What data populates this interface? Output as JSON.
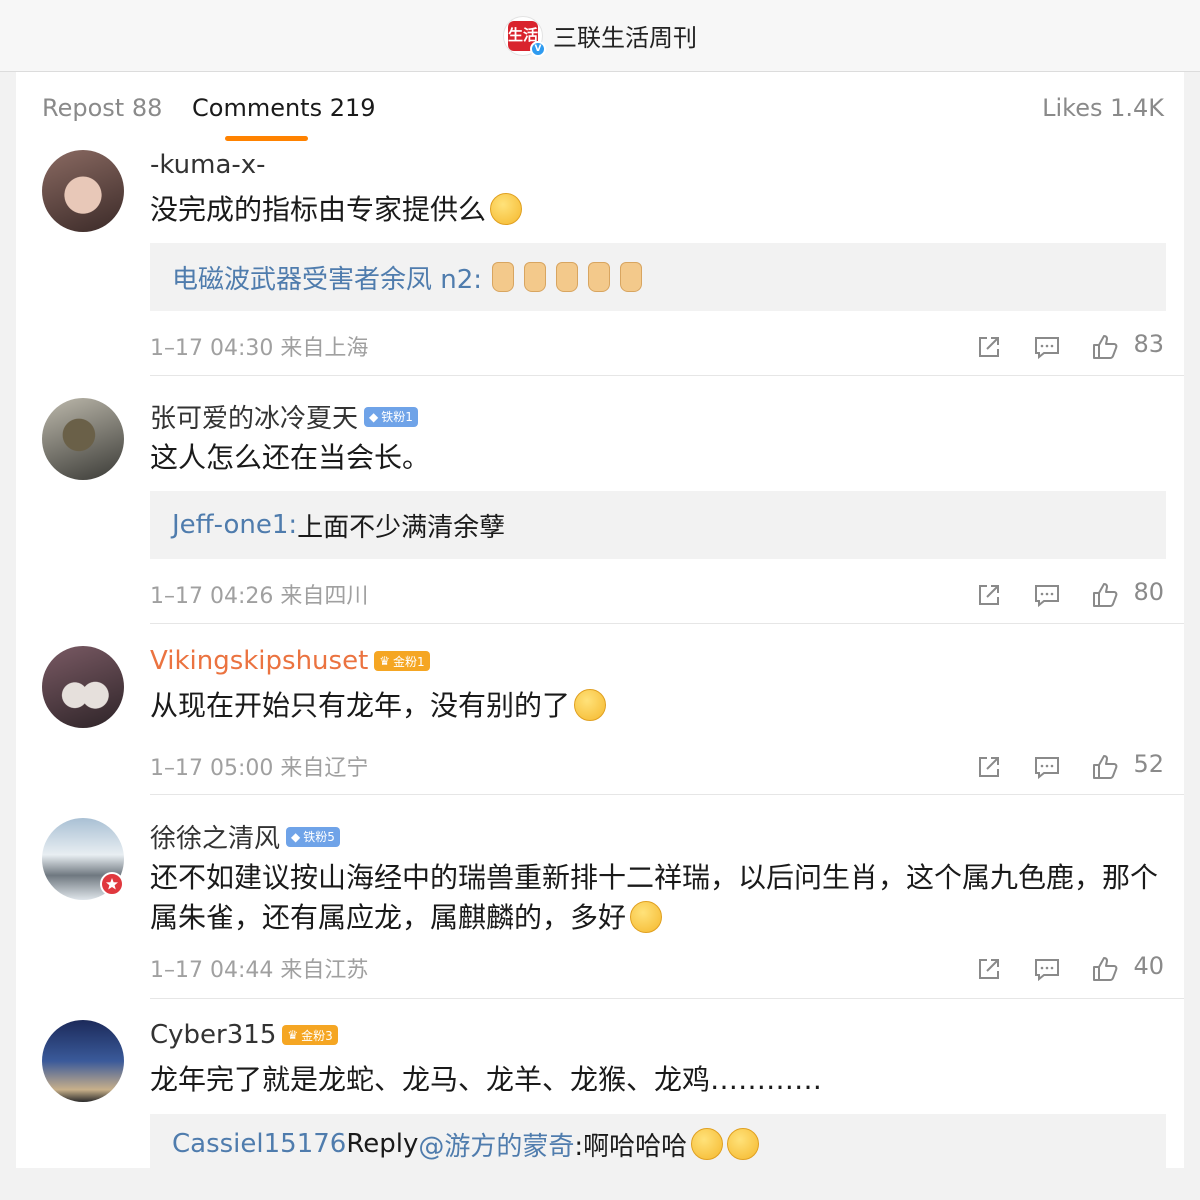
{
  "header": {
    "account_name": "三联生活周刊",
    "logo_text": "生活"
  },
  "tabs": {
    "repost": "Repost 88",
    "comments": "Comments 219",
    "likes": "Likes 1.4K"
  },
  "comments": [
    {
      "username": "-kuma-x-",
      "badge": "",
      "text": "没完成的指标由专家提供么",
      "reply_author": "电磁波武器受害者余凤 n2:",
      "reply_text": "",
      "time_location": "1–17 04:30 来自上海",
      "likes": "83"
    },
    {
      "username": "张可爱的冰冷夏天",
      "badge": "铁粉1",
      "text": "这人怎么还在当会长。",
      "reply_author": "Jeff-one1:",
      "reply_text": " 上面不少满清余孽",
      "time_location": "1–17 04:26 来自四川",
      "likes": "80"
    },
    {
      "username": "Vikingskipshuset",
      "badge": "金粉1",
      "text": "从现在开始只有龙年，没有别的了",
      "time_location": "1–17 05:00 来自辽宁",
      "likes": "52"
    },
    {
      "username": "徐徐之清风",
      "badge": "铁粉5",
      "text": "还不如建议按山海经中的瑞兽重新排十二祥瑞，以后问生肖，这个属九色鹿，那个属朱雀，还有属应龙，属麒麟的，多好",
      "time_location": "1–17 04:44 来自江苏",
      "likes": "40"
    },
    {
      "username": "Cyber315",
      "badge": "金粉3",
      "text": "龙年完了就是龙蛇、龙马、龙羊、龙猴、龙鸡…………",
      "reply_author": "Cassiel15176",
      "reply_mid": "Reply",
      "reply_at": "@游方的蒙奇",
      "reply_text": ":啊哈哈哈"
    }
  ]
}
